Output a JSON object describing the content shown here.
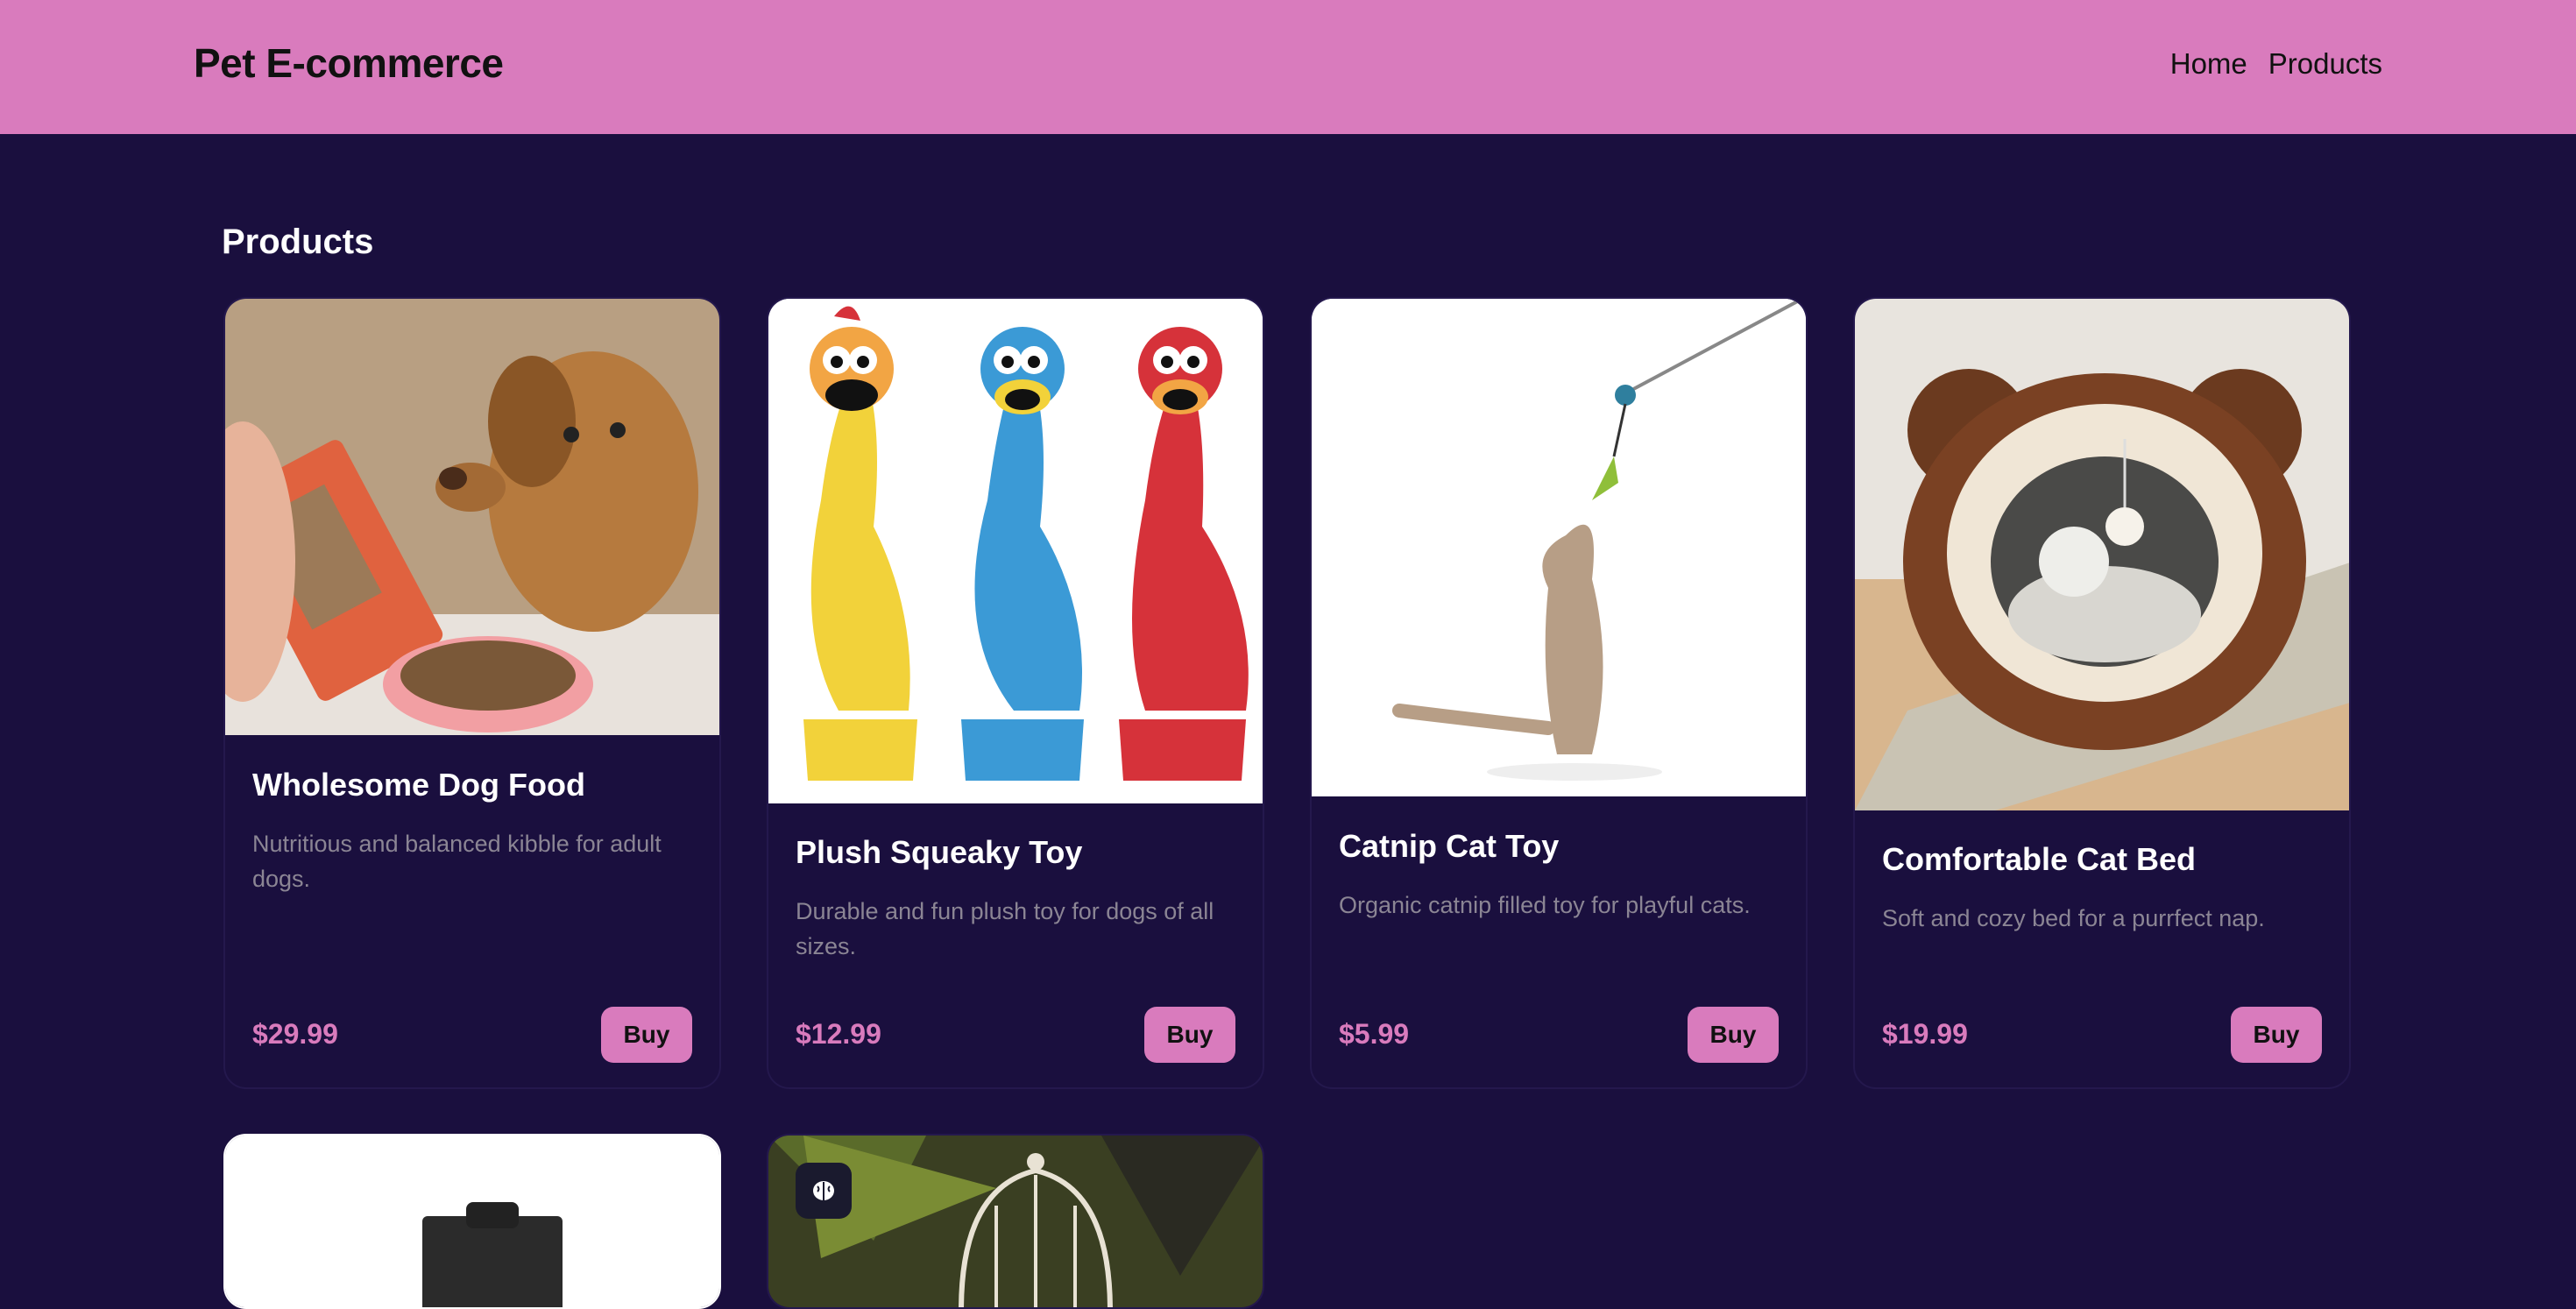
{
  "header": {
    "brand": "Pet E-commerce",
    "nav": [
      {
        "label": "Home"
      },
      {
        "label": "Products"
      }
    ]
  },
  "main": {
    "section_title": "Products",
    "products": [
      {
        "title": "Wholesome Dog Food",
        "description": "Nutritious and balanced kibble for adult dogs.",
        "price": "$29.99",
        "buy_label": "Buy",
        "image": "dog-food-photo"
      },
      {
        "title": "Plush Squeaky Toy",
        "description": "Durable and fun plush toy for dogs of all sizes.",
        "price": "$12.99",
        "buy_label": "Buy",
        "image": "rubber-chickens-photo"
      },
      {
        "title": "Catnip Cat Toy",
        "description": "Organic catnip filled toy for playful cats.",
        "price": "$5.99",
        "buy_label": "Buy",
        "image": "cat-playing-photo"
      },
      {
        "title": "Comfortable Cat Bed",
        "description": "Soft and cozy bed for a purrfect nap.",
        "price": "$19.99",
        "buy_label": "Buy",
        "image": "cat-bed-photo"
      },
      {
        "image": "feeder-photo"
      },
      {
        "image": "birdcage-photo",
        "badge_icon": "brain-icon"
      }
    ]
  },
  "colors": {
    "header_bg": "#d97bbd",
    "page_bg": "#1a0f3e",
    "accent": "#d97bbd",
    "muted_text": "#8b8594"
  }
}
